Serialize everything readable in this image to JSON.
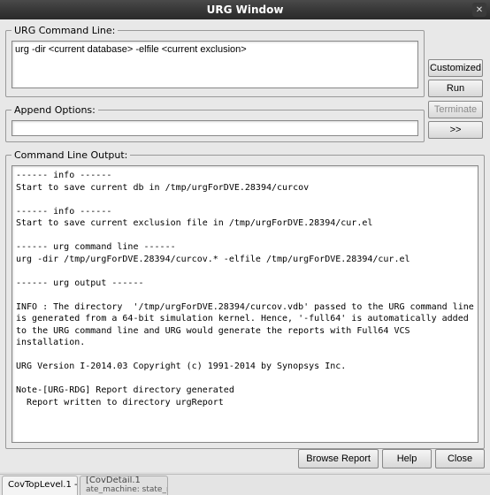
{
  "window": {
    "title": "URG Window"
  },
  "urg_command": {
    "legend": "URG Command Line:",
    "value": "urg -dir <current database> -elfile <current exclusion>"
  },
  "side_buttons": {
    "customized": "Customized",
    "run": "Run",
    "terminate": "Terminate",
    "more": ">>"
  },
  "append": {
    "legend": "Append Options:",
    "value": ""
  },
  "output": {
    "legend": "Command Line Output:",
    "text": "------ info ------\nStart to save current db in /tmp/urgForDVE.28394/curcov\n\n------ info ------\nStart to save current exclusion file in /tmp/urgForDVE.28394/cur.el\n\n------ urg command line ------\nurg -dir /tmp/urgForDVE.28394/curcov.* -elfile /tmp/urgForDVE.28394/cur.el\n\n------ urg output ------\n\nINFO : The directory  '/tmp/urgForDVE.28394/curcov.vdb' passed to the URG command line is generated from a 64-bit simulation kernel. Hence, '-full64' is automatically added to the URG command line and URG would generate the reports with Full64 VCS installation.\n\nURG Version I-2014.03 Copyright (c) 1991-2014 by Synopsys Inc.\n\nNote-[URG-RDG] Report directory generated\n  Report written to directory urgReport\n"
  },
  "footer": {
    "browse": "Browse Report",
    "help": "Help",
    "close": "Close"
  },
  "tabs": {
    "tab1_top": "CovTopLevel.1 -",
    "tab1_sub": "",
    "tab2_top": "[CovDetail.1",
    "tab2_sub": "ate_machine: state_machine.v]"
  }
}
